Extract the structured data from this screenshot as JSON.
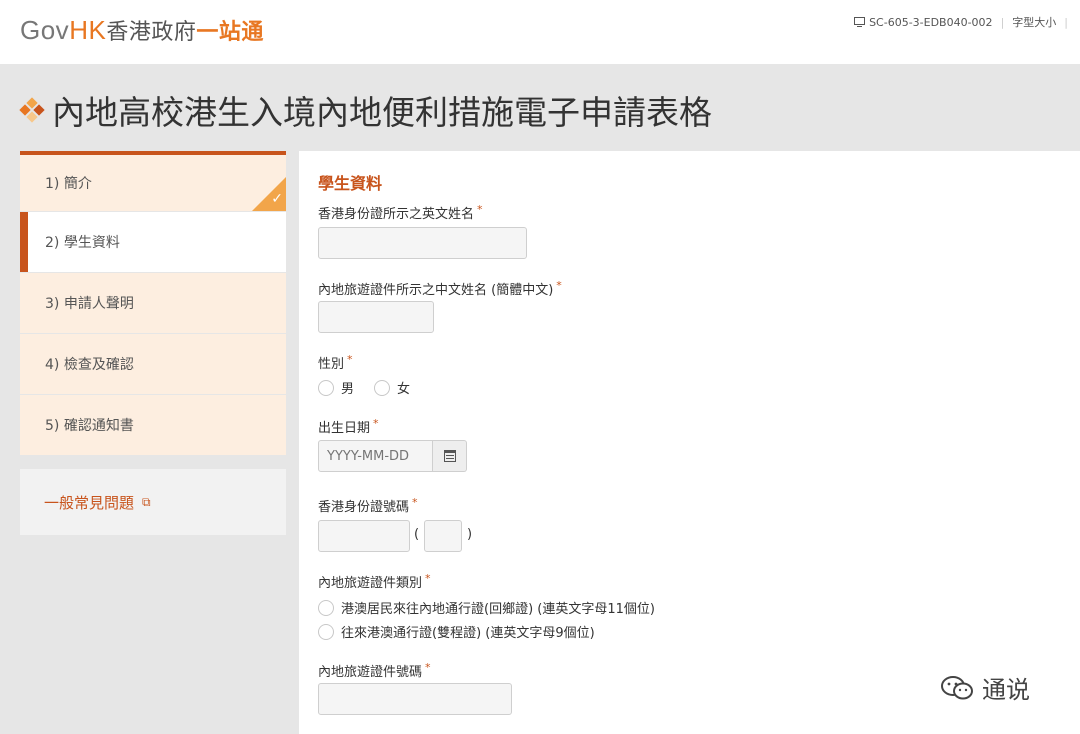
{
  "header": {
    "logo_gov": "Gov",
    "logo_hk": "HK",
    "logo_cn1": "香港政府",
    "logo_cn2": "一站通",
    "form_code": "SC-605-3-EDB040-002",
    "font_size_label": "字型大小"
  },
  "page": {
    "title": "內地高校港生入境內地便利措施電子申請表格"
  },
  "sidebar": {
    "steps": [
      {
        "label": "1)  簡介",
        "state": "completed"
      },
      {
        "label": "2)  學生資料",
        "state": "active"
      },
      {
        "label": "3)  申請人聲明",
        "state": "pending"
      },
      {
        "label": "4)  檢查及確認",
        "state": "pending"
      },
      {
        "label": "5)  確認通知書",
        "state": "pending"
      }
    ],
    "faq_label": "一般常見問題"
  },
  "form": {
    "section_title": "學生資料",
    "english_name_label": "香港身份證所示之英文姓名",
    "english_name_value": "",
    "chinese_name_label": "內地旅遊證件所示之中文姓名 (簡體中文)",
    "chinese_name_value": "",
    "gender_label": "性別",
    "gender_options": [
      "男",
      "女"
    ],
    "dob_label": "出生日期",
    "dob_placeholder": "YYYY-MM-DD",
    "hkid_label": "香港身份證號碼",
    "hkid_open_paren": "(",
    "hkid_close_paren": ")",
    "doc_type_label": "內地旅遊證件類別",
    "doc_type_options": [
      "港澳居民來往內地通行證(回鄉證) (連英文字母11個位)",
      "往來港澳通行證(雙程證) (連英文字母9個位)"
    ],
    "doc_number_label": "內地旅遊證件號碼",
    "required_mark": "*"
  },
  "watermark": {
    "text": "通说"
  },
  "colors": {
    "accent": "#c8541c",
    "brand_orange": "#e87722",
    "step_bg": "#fdeee0",
    "tick": "#f2a54a",
    "band": "#e6e6e6"
  }
}
